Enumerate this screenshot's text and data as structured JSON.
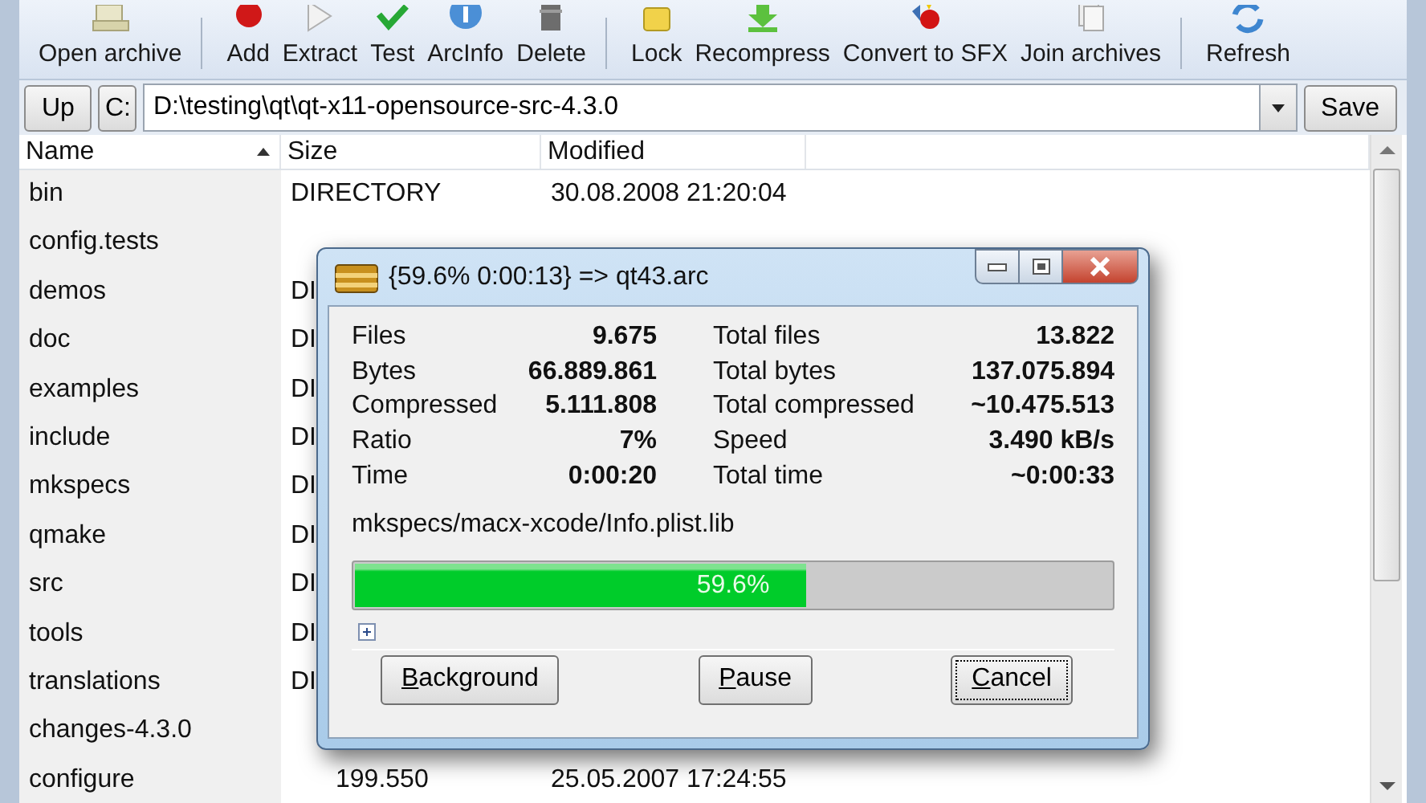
{
  "toolbar": {
    "groups": [
      [
        {
          "label": "Open archive"
        }
      ],
      [
        {
          "label": "Add"
        },
        {
          "label": "Extract"
        },
        {
          "label": "Test"
        },
        {
          "label": "ArcInfo"
        },
        {
          "label": "Delete"
        }
      ],
      [
        {
          "label": "Lock"
        },
        {
          "label": "Recompress"
        },
        {
          "label": "Convert to SFX"
        },
        {
          "label": "Join archives"
        }
      ],
      [
        {
          "label": "Refresh"
        }
      ]
    ]
  },
  "address_bar": {
    "up": "Up",
    "drive": "C:",
    "path": "D:\\testing\\qt\\qt-x11-opensource-src-4.3.0",
    "save": "Save"
  },
  "table": {
    "columns": [
      {
        "label": "Name",
        "sorted": true
      },
      {
        "label": "Size",
        "sorted": false
      },
      {
        "label": "Modified",
        "sorted": false
      }
    ],
    "rows": [
      {
        "name": "bin",
        "size": "DIRECTORY",
        "modified": "30.08.2008 21:20:04"
      },
      {
        "name": "config.tests"
      },
      {
        "name": "demos",
        "size": "DI"
      },
      {
        "name": "doc",
        "size": "DI"
      },
      {
        "name": "examples",
        "size": "DI"
      },
      {
        "name": "include",
        "size": "DI"
      },
      {
        "name": "mkspecs",
        "size": "DI"
      },
      {
        "name": "qmake",
        "size": "DI"
      },
      {
        "name": "src",
        "size": "DI"
      },
      {
        "name": "tools",
        "size": "DI"
      },
      {
        "name": "translations",
        "size": "DI"
      },
      {
        "name": "changes-4.3.0"
      },
      {
        "name": "configure",
        "size": "199.550",
        "modified": "25.05.2007 17:24:55"
      }
    ]
  },
  "dialog": {
    "title": "{59.6% 0:00:13} => qt43.arc",
    "stats_left": [
      {
        "label": "Files",
        "value": "9.675"
      },
      {
        "label": "Bytes",
        "value": "66.889.861"
      },
      {
        "label": "Compressed",
        "value": "5.111.808"
      },
      {
        "label": "Ratio",
        "value": "7%"
      },
      {
        "label": "Time",
        "value": "0:00:20"
      }
    ],
    "stats_right": [
      {
        "label": "Total files",
        "value": "13.822"
      },
      {
        "label": "Total bytes",
        "value": "137.075.894"
      },
      {
        "label": "Total compressed",
        "value": "~10.475.513"
      },
      {
        "label": "Speed",
        "value": "3.490 kB/s"
      },
      {
        "label": "Total time",
        "value": "~0:00:33"
      }
    ],
    "current_file": "mkspecs/macx-xcode/Info.plist.lib",
    "progress": {
      "level": 0.596,
      "text": "59.6%"
    },
    "details_expanded": false,
    "buttons": [
      {
        "label": "Background",
        "focused": false
      },
      {
        "label": "Pause",
        "focused": false
      },
      {
        "label": "Cancel",
        "focused": true
      }
    ]
  }
}
